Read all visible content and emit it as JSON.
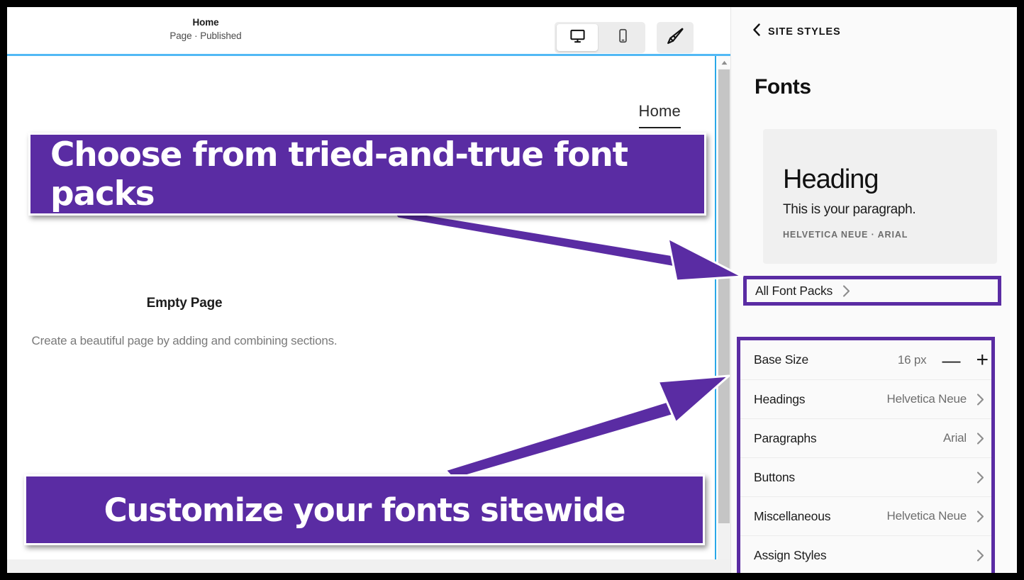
{
  "colors": {
    "accent_purple": "#5a2ca3",
    "canvas_border_blue": "#29a8e8",
    "panel_bg": "#fafafa",
    "preview_card_bg": "#f0f0f0"
  },
  "editor": {
    "topbar": {
      "page_title": "Home",
      "page_status": "Page · Published",
      "desktop_icon": "desktop-monitor-icon",
      "mobile_icon": "mobile-phone-icon",
      "brush_icon": "paintbrush-icon"
    },
    "canvas": {
      "site_nav_link": "Home",
      "empty_title": "Empty Page",
      "empty_description": "Create a beautiful page by adding and combining sections.",
      "scroll_up_icon": "scroll-up-arrow-icon"
    }
  },
  "annotations": {
    "banner_top": "Choose from tried-and-true font packs",
    "banner_bottom": "Customize your fonts sitewide",
    "arrow_top_icon": "arrow-pointing-right-down-icon",
    "arrow_bottom_icon": "arrow-pointing-right-up-icon"
  },
  "panel": {
    "back_icon": "chevron-left-icon",
    "back_label": "SITE STYLES",
    "title": "Fonts",
    "preview": {
      "heading": "Heading",
      "paragraph": "This is your paragraph.",
      "font_names": "HELVETICA NEUE · ARIAL"
    },
    "all_font_packs": {
      "label": "All Font Packs",
      "chevron_icon": "chevron-right-icon"
    },
    "base_size": {
      "label": "Base Size",
      "value": "16 px",
      "decrease_label": "—",
      "increase_label": "+",
      "decrease_icon": "minus-icon",
      "increase_icon": "plus-icon"
    },
    "rows": [
      {
        "label": "Headings",
        "value": "Helvetica Neue",
        "chevron_icon": "chevron-right-icon"
      },
      {
        "label": "Paragraphs",
        "value": "Arial",
        "chevron_icon": "chevron-right-icon"
      },
      {
        "label": "Buttons",
        "value": "",
        "chevron_icon": "chevron-right-icon"
      },
      {
        "label": "Miscellaneous",
        "value": "Helvetica Neue",
        "chevron_icon": "chevron-right-icon"
      },
      {
        "label": "Assign Styles",
        "value": "",
        "chevron_icon": "chevron-right-icon"
      }
    ]
  }
}
